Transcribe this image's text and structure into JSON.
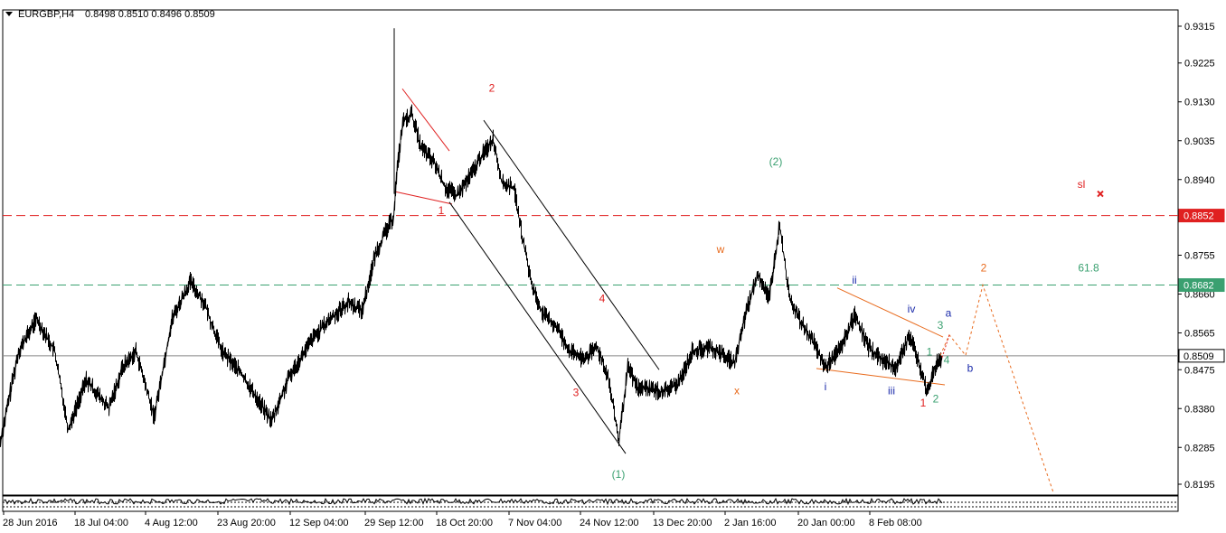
{
  "header": {
    "symbol": "EURGBP,H4",
    "ohlc": "0.8498 0.8510 0.8496 0.8509"
  },
  "colors": {
    "red": "#e02020",
    "green": "#3aa070",
    "blue": "#1a2aaa",
    "orange": "#e86a1c",
    "black": "#000000"
  },
  "chart_data": {
    "type": "line",
    "title": "EURGBP,H4",
    "y_ticks": [
      "0.9315",
      "0.9225",
      "0.9130",
      "0.9035",
      "0.8940",
      "0.8755",
      "0.8660",
      "0.8565",
      "0.8475",
      "0.8380",
      "0.8285",
      "0.8195"
    ],
    "ylim": [
      0.817,
      0.9345
    ],
    "x_ticks": [
      "28 Jun 2016",
      "18 Jul 04:00",
      "4 Aug 12:00",
      "23 Aug 20:00",
      "12 Sep 04:00",
      "29 Sep 12:00",
      "18 Oct 20:00",
      "7 Nov 04:00",
      "24 Nov 12:00",
      "13 Dec 20:00",
      "2 Jan 16:00",
      "20 Jan 00:00",
      "8 Feb 08:00"
    ],
    "price_path": [
      [
        0,
        0.83
      ],
      [
        20,
        0.852
      ],
      [
        40,
        0.86
      ],
      [
        60,
        0.852
      ],
      [
        75,
        0.833
      ],
      [
        95,
        0.845
      ],
      [
        120,
        0.838
      ],
      [
        135,
        0.848
      ],
      [
        150,
        0.852
      ],
      [
        170,
        0.836
      ],
      [
        190,
        0.86
      ],
      [
        210,
        0.869
      ],
      [
        225,
        0.864
      ],
      [
        245,
        0.852
      ],
      [
        265,
        0.847
      ],
      [
        285,
        0.84
      ],
      [
        300,
        0.835
      ],
      [
        320,
        0.846
      ],
      [
        345,
        0.855
      ],
      [
        365,
        0.86
      ],
      [
        385,
        0.864
      ],
      [
        400,
        0.862
      ],
      [
        415,
        0.876
      ],
      [
        428,
        0.882
      ],
      [
        435,
        0.885
      ],
      [
        438,
        0.895
      ],
      [
        445,
        0.908
      ],
      [
        455,
        0.91
      ],
      [
        465,
        0.902
      ],
      [
        480,
        0.898
      ],
      [
        492,
        0.892
      ],
      [
        505,
        0.89
      ],
      [
        520,
        0.895
      ],
      [
        530,
        0.899
      ],
      [
        545,
        0.904
      ],
      [
        555,
        0.893
      ],
      [
        568,
        0.892
      ],
      [
        578,
        0.879
      ],
      [
        588,
        0.868
      ],
      [
        600,
        0.861
      ],
      [
        615,
        0.858
      ],
      [
        630,
        0.852
      ],
      [
        645,
        0.85
      ],
      [
        660,
        0.853
      ],
      [
        672,
        0.846
      ],
      [
        684,
        0.83
      ],
      [
        694,
        0.848
      ],
      [
        705,
        0.843
      ],
      [
        718,
        0.843
      ],
      [
        732,
        0.842
      ],
      [
        750,
        0.844
      ],
      [
        765,
        0.852
      ],
      [
        785,
        0.853
      ],
      [
        800,
        0.851
      ],
      [
        812,
        0.849
      ],
      [
        825,
        0.862
      ],
      [
        838,
        0.871
      ],
      [
        850,
        0.865
      ],
      [
        862,
        0.883
      ],
      [
        872,
        0.866
      ],
      [
        885,
        0.859
      ],
      [
        900,
        0.854
      ],
      [
        912,
        0.848
      ],
      [
        930,
        0.853
      ],
      [
        945,
        0.861
      ],
      [
        960,
        0.853
      ],
      [
        975,
        0.85
      ],
      [
        990,
        0.848
      ],
      [
        1005,
        0.856
      ],
      [
        1015,
        0.85
      ],
      [
        1025,
        0.842
      ],
      [
        1035,
        0.849
      ],
      [
        1042,
        0.8509
      ]
    ],
    "levels": [
      {
        "value": 0.8852,
        "label": "0.8852",
        "style": "dashed",
        "color": "#e02020"
      },
      {
        "value": 0.8682,
        "label": "0.8682",
        "style": "dashed",
        "color": "#3aa070"
      },
      {
        "value": 0.8509,
        "label": "0.8509",
        "style": "solid",
        "color": "#000000"
      }
    ],
    "annotations": [
      {
        "text": "1",
        "t": 488,
        "v": 0.8855,
        "color": "#e02020"
      },
      {
        "text": "2",
        "t": 544,
        "v": 0.9155,
        "color": "#e02020"
      },
      {
        "text": "3",
        "t": 637,
        "v": 0.841,
        "color": "#e02020"
      },
      {
        "text": "4",
        "t": 666,
        "v": 0.864,
        "color": "#e02020"
      },
      {
        "text": "(1)",
        "t": 684,
        "v": 0.821,
        "color": "#3aa070"
      },
      {
        "text": "w",
        "t": 797,
        "v": 0.876,
        "color": "#e86a1c"
      },
      {
        "text": "x",
        "t": 815,
        "v": 0.8415,
        "color": "#e86a1c"
      },
      {
        "text": "(2)",
        "t": 858,
        "v": 0.8975,
        "color": "#3aa070"
      },
      {
        "text": "i",
        "t": 913,
        "v": 0.8425,
        "color": "#1a2aaa"
      },
      {
        "text": "ii",
        "t": 945,
        "v": 0.8685,
        "color": "#1a2aaa"
      },
      {
        "text": "iii",
        "t": 986,
        "v": 0.8415,
        "color": "#1a2aaa"
      },
      {
        "text": "iv",
        "t": 1008,
        "v": 0.8615,
        "color": "#1a2aaa"
      },
      {
        "text": "1",
        "t": 1021,
        "v": 0.8385,
        "color": "#e02020"
      },
      {
        "text": "1",
        "t": 1028,
        "v": 0.851,
        "color": "#3aa070"
      },
      {
        "text": "2",
        "t": 1035,
        "v": 0.8395,
        "color": "#3aa070"
      },
      {
        "text": "3",
        "t": 1040,
        "v": 0.8575,
        "color": "#3aa070"
      },
      {
        "text": "4",
        "t": 1047,
        "v": 0.849,
        "color": "#3aa070"
      },
      {
        "text": "a",
        "t": 1049,
        "v": 0.8605,
        "color": "#1a2aaa"
      },
      {
        "text": "b",
        "t": 1073,
        "v": 0.847,
        "color": "#1a2aaa"
      },
      {
        "text": "2",
        "t": 1088,
        "v": 0.8715,
        "color": "#e86a1c"
      },
      {
        "text": "sl",
        "t": 1196,
        "v": 0.892,
        "color": "#e02020"
      },
      {
        "text": "61.8",
        "t": 1204,
        "v": 0.8715,
        "color": "#3aa070"
      }
    ],
    "lines": [
      {
        "points": [
          [
            445,
            0.9162
          ],
          [
            497,
            0.901
          ]
        ],
        "color": "#e02020"
      },
      {
        "points": [
          [
            438,
            0.891
          ],
          [
            500,
            0.888
          ]
        ],
        "color": "#e02020"
      },
      {
        "points": [
          [
            497,
            0.8885
          ],
          [
            692,
            0.827
          ]
        ],
        "color": "#000000"
      },
      {
        "points": [
          [
            535,
            0.9085
          ],
          [
            729,
            0.8475
          ]
        ],
        "color": "#000000"
      },
      {
        "points": [
          [
            926,
            0.8675
          ],
          [
            1043,
            0.8555
          ]
        ],
        "color": "#e86a1c"
      },
      {
        "points": [
          [
            903,
            0.8478
          ],
          [
            1045,
            0.8438
          ]
        ],
        "color": "#e86a1c"
      }
    ],
    "forecast_path": [
      [
        1040,
        0.851
      ],
      [
        1050,
        0.856
      ],
      [
        1068,
        0.851
      ],
      [
        1087,
        0.8682
      ],
      [
        1165,
        0.8175
      ]
    ],
    "forecast_color": "#e86a1c",
    "sl_marker": {
      "t": 1217,
      "v": 0.8905,
      "color": "#e02020"
    }
  }
}
